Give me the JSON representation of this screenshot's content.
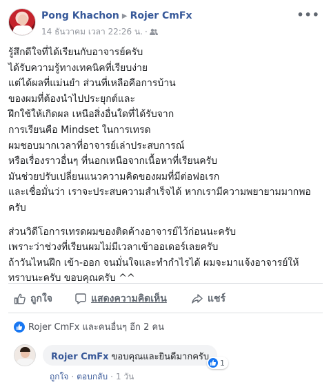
{
  "post": {
    "author": "Pong Khachon",
    "recipient": "Rojer CmFx",
    "timestamp": "14 ธันวาคม เวลา 22:26 น.",
    "audience_icon": "friends-icon",
    "more_label": "•••",
    "body_lines": [
      "รู้สึกดีใจที่ได้เรียนกับอาจารย์ครับ",
      "ได้รับความรู้ทางเทคนิคที่เรียบง่าย",
      "แต่ได้ผลที่แม่นยำ ส่วนที่เหลือคือการบ้าน",
      "ของผมที่ต้องนำไปประยุกต์และ",
      "ฝึกใช้ให้เกิดผล เหนือสิ่งอื่นใดที่ได้รับจาก",
      "การเรียนคือ Mindset ในการเทรด",
      "ผมชอบมากเวลาที่อาจารย์เล่าประสบการณ์",
      "หรือเรื่องราวอื่นๆ ที่นอกเหนือจากเนื้อหาที่เรียนครับ",
      "มันช่วยปรับเปลี่ยนแนวความคิดของผมที่มีต่อฟอเรก",
      "และเชื่อมั่นว่า เราจะประสบความสำเร็จได้ หากเรามีความพยายามมากพอ",
      "ครับ"
    ],
    "body_lines_2": [
      "ส่วนวิดีโอการเทรดผมของติดค้างอาจารย์ไว้ก่อนนะครับ",
      "เพราะว่าช่วงที่เรียนผมไม่มีเวลาเข้าออเดอร์เลยครับ",
      "ถ้าวันไหนฝึก เข้า-ออก จนมั่นใจและทำกำไรได้ ผมจะมาแจ้งอาจารย์ให้",
      "ทราบนะครับ ขอบคุณครับ ^^"
    ]
  },
  "actions": {
    "like_label": "ถูกใจ",
    "comment_label": "แสดงความคิดเห็น",
    "share_label": "แชร์"
  },
  "reactions": {
    "summary": "Rojer CmFx และคนอื่นๆ อีก 2 คน"
  },
  "comment": {
    "author": "Rojer CmFx",
    "text": "ขอบคุณและยินดีมากครับ",
    "reaction_count": "1",
    "like_label": "ถูกใจ",
    "reply_label": "ตอบกลับ",
    "time": "1 วัน",
    "separator": "·"
  },
  "colors": {
    "name_link": "#365899",
    "like_blue": "#1877f2",
    "meta_gray": "#90949c",
    "divider": "#dadde1",
    "bubble_bg": "#f2f3f5"
  }
}
